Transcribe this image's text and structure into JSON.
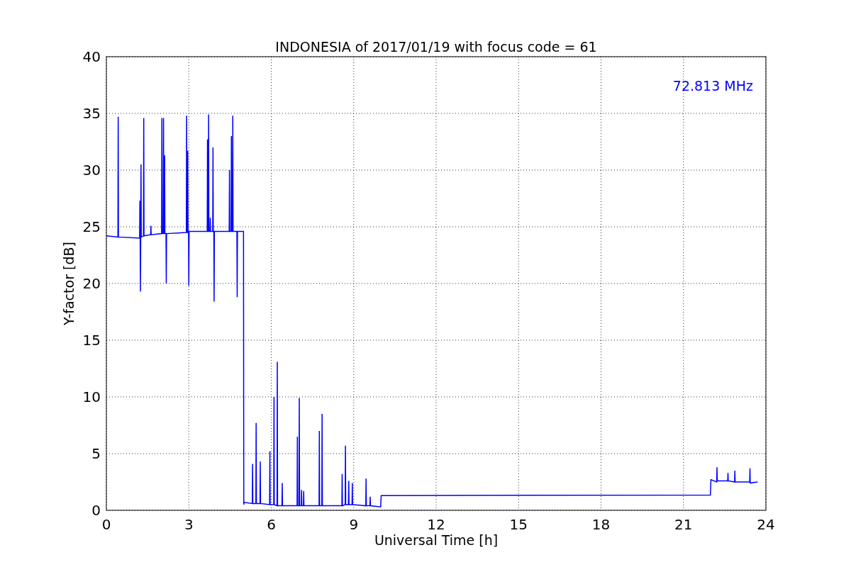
{
  "chart_data": {
    "type": "line",
    "title": "INDONESIA of 2017/01/19 with focus code = 61",
    "xlabel": "Universal Time [h]",
    "ylabel": "Y-factor [dB]",
    "x": [
      0,
      0.42,
      0.43,
      0.44,
      1.21,
      1.22,
      1.23,
      1.24,
      1.25,
      1.26,
      1.27,
      1.35,
      1.36,
      1.37,
      1.61,
      1.62,
      1.63,
      2.01,
      2.02,
      2.03,
      2.07,
      2.08,
      2.09,
      2.11,
      2.12,
      2.13,
      2.17,
      2.18,
      2.19,
      2.91,
      2.92,
      2.93,
      2.95,
      2.96,
      2.97,
      2.99,
      3.0,
      3.01,
      3.67,
      3.68,
      3.69,
      3.71,
      3.72,
      3.73,
      3.77,
      3.78,
      3.79,
      3.87,
      3.88,
      3.89,
      3.91,
      3.92,
      3.93,
      4.47,
      4.48,
      4.49,
      4.54,
      4.55,
      4.56,
      4.59,
      4.6,
      4.61,
      4.75,
      4.76,
      4.77,
      4.99,
      5.0,
      5.01,
      5.31,
      5.32,
      5.33,
      5.44,
      5.45,
      5.46,
      5.59,
      5.6,
      5.61,
      5.94,
      5.95,
      5.96,
      6.09,
      6.1,
      6.11,
      6.21,
      6.22,
      6.23,
      6.39,
      6.4,
      6.41,
      6.94,
      6.95,
      6.96,
      7.01,
      7.02,
      7.03,
      7.09,
      7.1,
      7.11,
      7.17,
      7.18,
      7.19,
      7.74,
      7.75,
      7.76,
      7.84,
      7.85,
      7.86,
      8.57,
      8.58,
      8.59,
      8.69,
      8.7,
      8.71,
      8.81,
      8.82,
      8.83,
      8.94,
      8.95,
      8.96,
      9.44,
      9.45,
      9.46,
      9.59,
      9.6,
      9.61,
      9.98,
      10,
      21.98,
      22,
      22.21,
      22.22,
      22.23,
      22.61,
      22.62,
      22.63,
      22.86,
      22.87,
      22.88,
      23.41,
      23.42,
      23.43,
      23.7
    ],
    "series": [
      {
        "color": "#0000ff",
        "values": [
          24.2,
          24.1,
          34.7,
          24.1,
          24,
          27.3,
          24,
          19.3,
          24,
          30.5,
          24.1,
          24.2,
          34.6,
          24.2,
          24.3,
          25.1,
          24.3,
          24.4,
          34.6,
          24.4,
          24.4,
          34.6,
          24.4,
          24.4,
          31.3,
          24.4,
          24.4,
          20,
          24.4,
          24.5,
          34.8,
          24.5,
          24.5,
          31.7,
          24.5,
          24.5,
          19.8,
          24.6,
          24.6,
          32.7,
          24.6,
          24.6,
          34.9,
          24.6,
          24.6,
          25.8,
          24.6,
          24.6,
          32,
          24.6,
          24.6,
          18.4,
          24.6,
          24.6,
          30,
          24.6,
          24.6,
          33,
          24.6,
          24.6,
          34.8,
          24.6,
          24.6,
          18.8,
          24.6,
          24.6,
          0.5,
          0.7,
          0.6,
          4.1,
          0.6,
          0.6,
          7.7,
          0.6,
          0.6,
          4.3,
          0.6,
          0.5,
          5.2,
          0.5,
          0.5,
          10,
          0.5,
          0.4,
          13.1,
          0.4,
          0.4,
          2.4,
          0.4,
          0.4,
          6.5,
          0.4,
          0.4,
          9.9,
          0.4,
          0.4,
          1.8,
          0.4,
          0.4,
          1.7,
          0.4,
          0.4,
          7,
          0.4,
          0.4,
          8.5,
          0.4,
          0.4,
          3.2,
          0.4,
          0.5,
          5.7,
          0.5,
          0.5,
          2.6,
          0.5,
          0.5,
          2.4,
          0.5,
          0.4,
          2.8,
          0.4,
          0.4,
          1.2,
          0.4,
          0.3,
          1.3,
          1.35,
          2.7,
          2.5,
          3.8,
          2.6,
          2.6,
          3.3,
          2.6,
          2.5,
          3.5,
          2.5,
          2.5,
          3.7,
          2.4,
          2.5
        ]
      }
    ],
    "xlim": [
      0,
      24
    ],
    "ylim": [
      0,
      40
    ],
    "xticks": [
      0,
      3,
      6,
      9,
      12,
      15,
      18,
      21,
      24
    ],
    "yticks": [
      0,
      5,
      10,
      15,
      20,
      25,
      30,
      35,
      40
    ],
    "grid": true,
    "annotations": [
      "72.813 MHz"
    ]
  }
}
